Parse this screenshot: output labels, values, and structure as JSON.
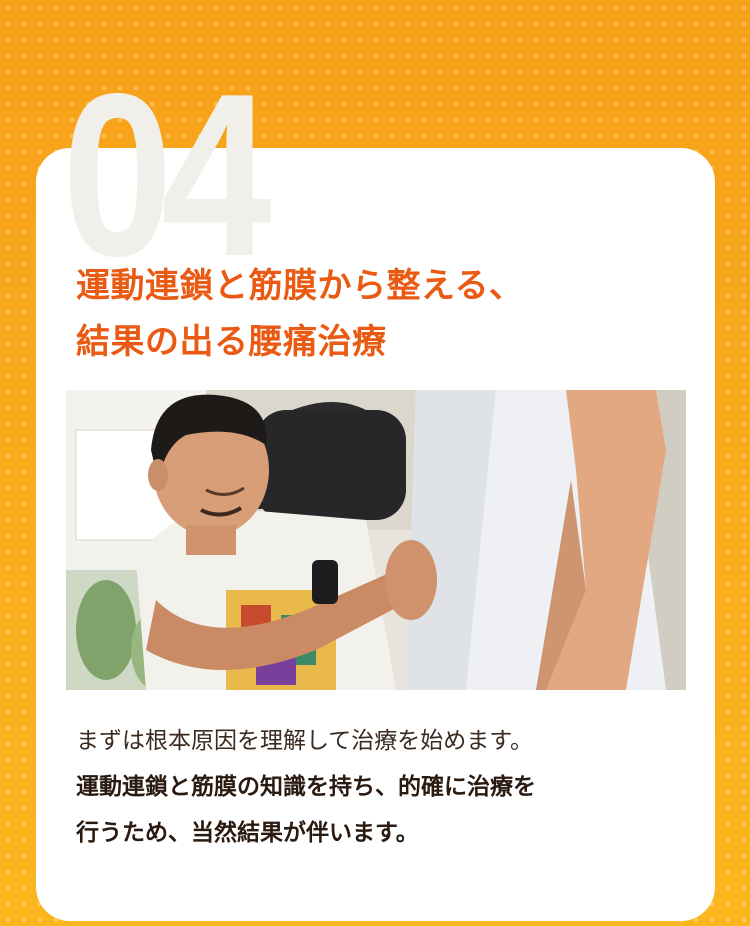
{
  "section": {
    "number": "04",
    "title_lines": [
      "運動連鎖と筋膜から整える、",
      "結果の出る腰痛治療"
    ]
  },
  "photo": {
    "alt": "施術者が患者の腰に手を当てて確認している写真"
  },
  "body": {
    "line1": "まずは根本原因を理解して治療を始めます。",
    "line2": "運動連鎖と筋膜の知識を持ち、的確に治療を",
    "line3": "行うため、当然結果が伴います。"
  },
  "colors": {
    "background": "#f9a91a",
    "title": "#ea5a12",
    "card": "#ffffff",
    "number": "#f1efea"
  }
}
